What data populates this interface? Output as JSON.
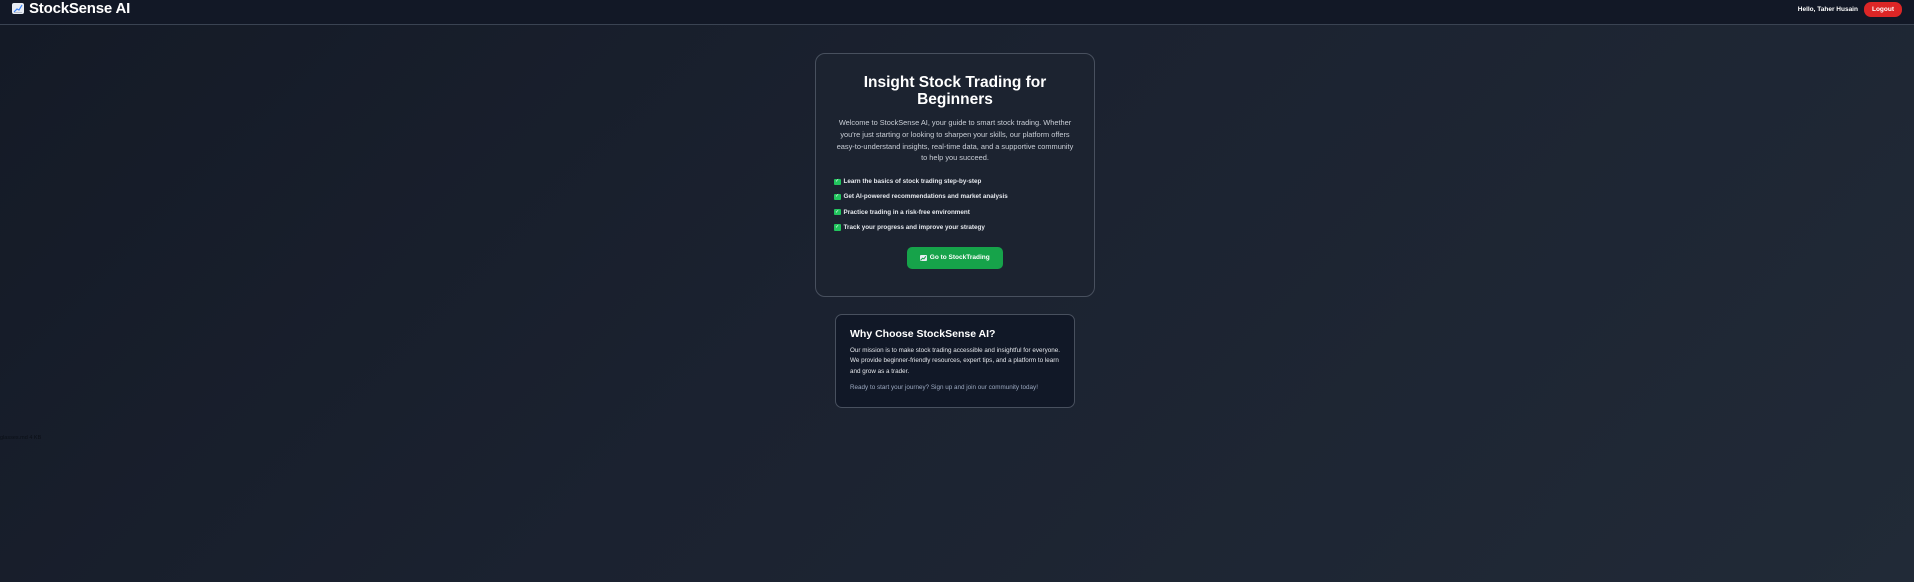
{
  "navbar": {
    "brand_icon": "chart-increasing-icon",
    "brand": "StockSense AI",
    "greeting": "Hello, Taher Husain",
    "logout_label": "Logout"
  },
  "hero": {
    "title": "Insight Stock Trading for Beginners",
    "description": "Welcome to StockSense AI, your guide to smart stock trading. Whether you're just starting or looking to sharpen your skills, our platform offers easy-to-understand insights, real-time data, and a supportive community to help you succeed.",
    "features": [
      "Learn the basics of stock trading step-by-step",
      "Get AI-powered recommendations and market analysis",
      "Practice trading in a risk-free environment",
      "Track your progress and improve your strategy"
    ],
    "feature_icon": "check-box-icon",
    "cta_icon": "chart-increasing-icon",
    "cta_label": "Go to StockTrading"
  },
  "why": {
    "title": "Why Choose StockSense AI?",
    "text": "Our mission is to make stock trading accessible and insightful for everyone. We provide beginner-friendly resources, expert tips, and a platform to learn and grow as a trader.",
    "cta_text": "Ready to start your journey? Sign up and join our community today!"
  },
  "stray_text": "glasses.md 4 KB",
  "colors": {
    "accent_green": "#16a34a",
    "check_green": "#22c55e",
    "logout_red": "#dc2626",
    "page_bg": "#1b2230"
  }
}
